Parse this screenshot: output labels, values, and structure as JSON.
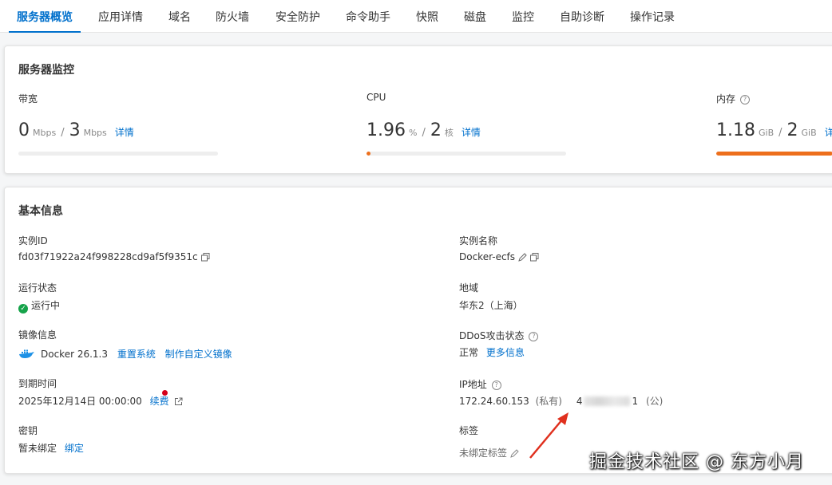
{
  "tabs": [
    {
      "label": "服务器概览",
      "active": true
    },
    {
      "label": "应用详情"
    },
    {
      "label": "域名"
    },
    {
      "label": "防火墙"
    },
    {
      "label": "安全防护"
    },
    {
      "label": "命令助手"
    },
    {
      "label": "快照"
    },
    {
      "label": "磁盘"
    },
    {
      "label": "监控"
    },
    {
      "label": "自助诊断"
    },
    {
      "label": "操作记录"
    }
  ],
  "monitor": {
    "title": "服务器监控",
    "bandwidth": {
      "label": "带宽",
      "used": "0",
      "used_unit": "Mbps",
      "sep": "/",
      "total": "3",
      "total_unit": "Mbps",
      "link": "详情",
      "usage": 0
    },
    "cpu": {
      "label": "CPU",
      "used": "1.96",
      "used_unit": "%",
      "sep": "/",
      "total": "2",
      "total_unit": "核",
      "link": "详情",
      "usage": 0.0196
    },
    "memory": {
      "label": "内存",
      "used": "1.18",
      "used_unit": "GiB",
      "sep": "/",
      "total": "2",
      "total_unit": "GiB",
      "link": "详",
      "usage": 1.0
    }
  },
  "basic": {
    "title": "基本信息",
    "instance_id": {
      "label": "实例ID",
      "value": "fd03f71922a24f998228cd9af5f9351c"
    },
    "instance_name": {
      "label": "实例名称",
      "value": "Docker-ecfs"
    },
    "run_status": {
      "label": "运行状态",
      "value": "运行中"
    },
    "region": {
      "label": "地域",
      "value": "华东2（上海）"
    },
    "image": {
      "label": "镜像信息",
      "value": "Docker 26.1.3",
      "link1": "重置系统",
      "link2": "制作自定义镜像"
    },
    "ddos": {
      "label": "DDoS攻击状态",
      "value": "正常",
      "link": "更多信息"
    },
    "expire": {
      "label": "到期时间",
      "value": "2025年12月14日 00:00:00",
      "link": "续费"
    },
    "ip": {
      "label": "IP地址",
      "private": "172.24.60.153",
      "private_tag": "(私有)",
      "public_start": "4",
      "public_end": "1",
      "public_tag": "(公)"
    },
    "key": {
      "label": "密钥",
      "value": "暂未绑定",
      "link": "绑定"
    },
    "tags": {
      "label": "标签",
      "value": "未绑定标签"
    }
  },
  "colors": {
    "accent": "#0070cc",
    "progress": "#ed6f1c",
    "running": "#16a34a",
    "annotation": "#e0301e"
  },
  "watermark": "掘金技术社区 @ 东方小月"
}
